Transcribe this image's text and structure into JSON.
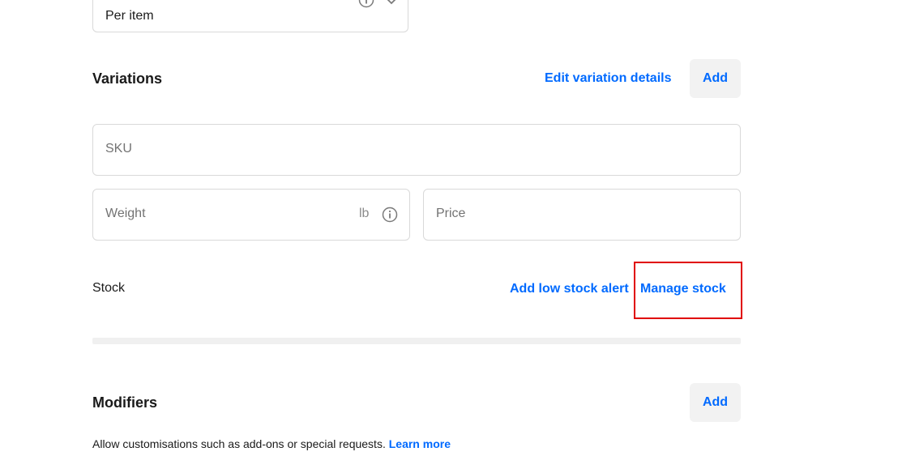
{
  "unit_select": {
    "value": "Per item",
    "info_icon": "info-icon",
    "chevron_icon": "chevron-down-icon"
  },
  "variations": {
    "title": "Variations",
    "edit_link": "Edit variation details",
    "add_button": "Add",
    "sku_placeholder": "SKU",
    "weight_placeholder": "Weight",
    "weight_unit": "lb",
    "price_placeholder": "Price"
  },
  "stock": {
    "label": "Stock",
    "low_stock_link": "Add low stock alert",
    "manage_stock_link": "Manage stock"
  },
  "modifiers": {
    "title": "Modifiers",
    "add_button": "Add",
    "helper_text": "Allow customisations such as add-ons or special requests.",
    "learn_more": "Learn more"
  },
  "colors": {
    "accent": "#006aff",
    "highlight": "#e00000",
    "border": "#d9d9d9",
    "button_bg": "#f2f2f2"
  }
}
